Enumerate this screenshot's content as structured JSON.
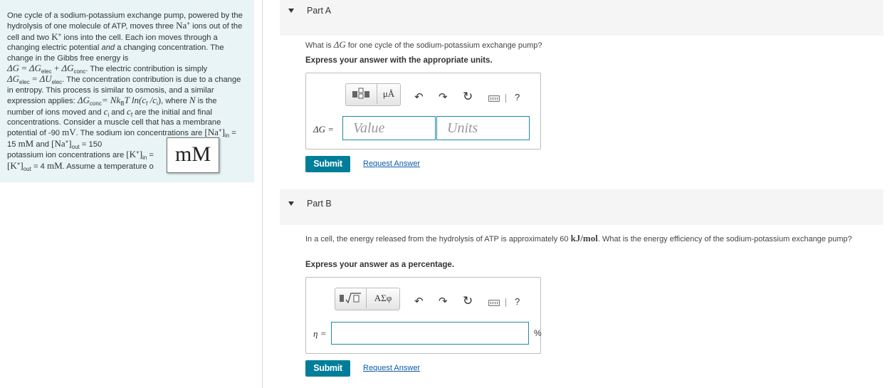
{
  "problem": {
    "p1": "One cycle of a sodium-potassium exchange pump, powered by the hydrolysis of one molecule of ATP, moves three ",
    "na": "Na",
    "p2": " ions out of the cell and two ",
    "k": "K",
    "p3": " ions into the cell. Each ion moves through a changing electric potential ",
    "and_word": "and",
    "p4": " a changing concentration. The change in the Gibbs free energy is",
    "eq1_lhs": "ΔG",
    "eq1_rhs_a": "ΔG",
    "eq1_sub_a": "elec",
    "eq1_rhs_b": "ΔG",
    "eq1_sub_b": "conc",
    "p5": ". The electric contribution is simply",
    "eq2_lhs": "ΔG",
    "eq2_sub": "elec",
    "eq2_rhs": "ΔU",
    "eq2_rhs_sub": "elec",
    "p6": ". The concentration contribution is due to a change in entropy. This process is similar to osmosis, and a similar expression applies: ",
    "eq3_lhs": "ΔG",
    "eq3_sub": "conc",
    "eq3_rhs": "= Nk",
    "eq3_B": "B",
    "eq3_rest": "T ln(c",
    "eq3_f": "f",
    "eq3_div": " /c",
    "eq3_i": "i",
    "eq3_close": ")",
    "p7": ", where ",
    "N": "N",
    "p8": " is the number of ions moved and ",
    "ci": "c",
    "ci_sub": "i",
    "p9": " and ",
    "cf": "c",
    "cf_sub": "f",
    "p10": " are the initial and final concentrations. Consider a muscle cell that has a membrane potential of -90 ",
    "mV": "mV",
    "p11": ". The sodium ion concentrations are ",
    "na_in_label": "[Na",
    "in_sub": "in",
    "na_in_val": " = 15 ",
    "mM": "mM",
    "p12": " and ",
    "out_sub": "out",
    "na_out_val": " = 150",
    "p13": "potassium ion concentrations are ",
    "k_label": "[K",
    "k_in_val": " = ",
    "k_out_val": " = 4 ",
    "p14": ". Assume a temperature o",
    "tooltip": "mM"
  },
  "partA": {
    "title": "Part A",
    "question_pre": "What is ",
    "question_sym": "ΔG",
    "question_post": " for one cycle of the sodium-potassium exchange pump?",
    "express": "Express your answer with the appropriate units.",
    "templates_icon": "templates-icon",
    "units_button": "μÅ",
    "label": "ΔG =",
    "value_placeholder": "Value",
    "units_placeholder": "Units",
    "help": "?",
    "submit": "Submit",
    "request": "Request Answer"
  },
  "partB": {
    "title": "Part B",
    "question_pre": "In a cell, the energy released from the hydrolysis of ATP is approximately 60 ",
    "question_unit": "kJ/mol",
    "question_post": ". What is the energy efficiency of the sodium-potassium exchange pump?",
    "express": "Express your answer as a percentage.",
    "symbols_button": "ΑΣφ",
    "label": "η =",
    "unit_suffix": "%",
    "help": "?",
    "submit": "Submit",
    "request": "Request Answer"
  },
  "colors": {
    "panel_bg": "#e8f4f6",
    "accent": "#007d99",
    "field_border": "#1f8ba3",
    "link": "#0e5ba7"
  }
}
